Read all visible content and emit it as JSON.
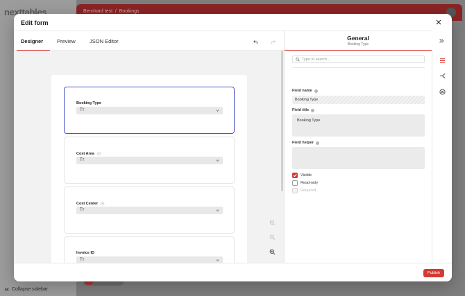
{
  "background": {
    "logo": "nexttables",
    "breadcrumb": {
      "base": "Bernhard test",
      "current": "Bookings"
    },
    "collapse_label": "Collapse sidebar"
  },
  "modal": {
    "title": "Edit form",
    "tabs": [
      {
        "label": "Designer",
        "active": true
      },
      {
        "label": "Preview",
        "active": false
      },
      {
        "label": "JSON Editor",
        "active": false
      }
    ],
    "fields": [
      {
        "label": "Booking Type",
        "type_glyph": "Tт",
        "selected": true,
        "icon": "none"
      },
      {
        "label": "Cost Area",
        "type_glyph": "Tт",
        "selected": false,
        "icon": "gear-icon"
      },
      {
        "label": "Cost Center",
        "type_glyph": "Tт",
        "selected": false,
        "icon": "gear-icon"
      },
      {
        "label": "Invoice ID",
        "type_glyph": "Tт",
        "selected": false,
        "icon": "none"
      }
    ],
    "panel": {
      "title": "General",
      "subtitle": "Booking Type",
      "search_placeholder": "Type to search...",
      "field_name_label": "Field name",
      "field_name_value": "Booking Type",
      "field_title_label": "Field title",
      "field_title_value": "Booking Type",
      "field_helper_label": "Field helper",
      "field_helper_value": "",
      "checks": [
        {
          "label": "Visible",
          "checked": true,
          "disabled": false
        },
        {
          "label": "Read-only",
          "checked": false,
          "disabled": false
        },
        {
          "label": "Required",
          "checked": false,
          "disabled": true
        }
      ]
    },
    "publish_label": "Publish"
  },
  "colors": {
    "accent": "#d33b34",
    "selection": "#4a52c9"
  }
}
